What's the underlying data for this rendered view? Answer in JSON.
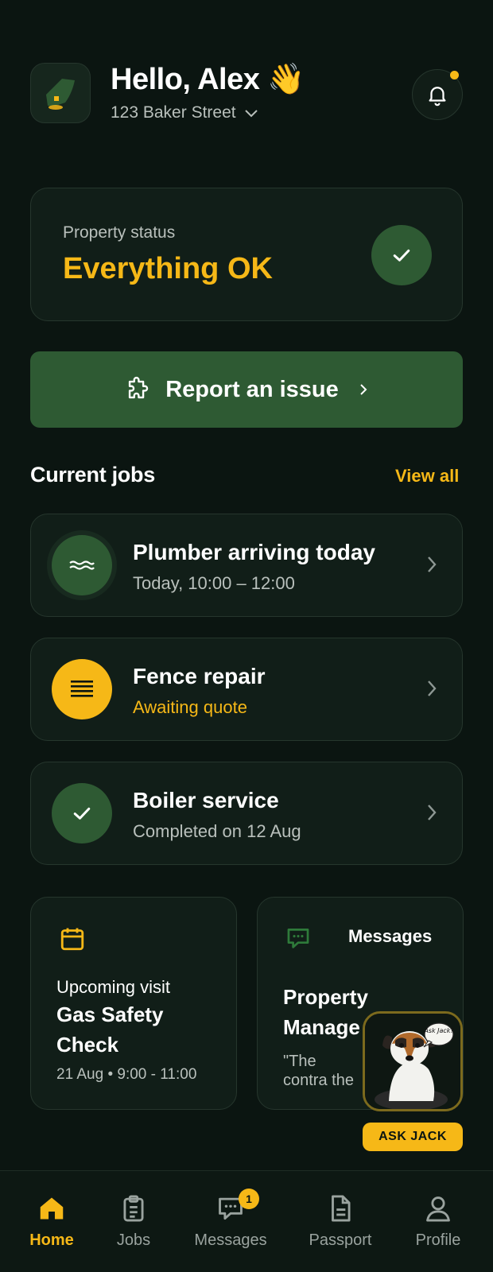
{
  "header": {
    "greeting": "Hello, Alex 👋",
    "address": "123 Baker Street",
    "notification_dot": true
  },
  "status": {
    "label": "Property status",
    "value": "Everything OK"
  },
  "report_button": {
    "label": "Report an issue"
  },
  "jobs_section": {
    "title": "Current jobs",
    "view_all": "View all",
    "jobs": [
      {
        "title": "Plumber arriving today",
        "subtitle": "Today, 10:00 – 12:00",
        "icon": "water-wave-icon"
      },
      {
        "title": "Fence repair",
        "subtitle": "Awaiting quote",
        "icon": "fence-lines-icon"
      },
      {
        "title": "Boiler service",
        "subtitle": "Completed on 12 Aug",
        "icon": "check-icon"
      }
    ]
  },
  "upcoming": {
    "label": "Upcoming visit",
    "title": "Gas Safety Check",
    "meta": "21 Aug • 9:00 - 11:00"
  },
  "messages_card": {
    "label": "Messages",
    "title": "Property Manage",
    "quote": "\"The contra the way.\""
  },
  "ask_jack": {
    "button": "ASK JACK",
    "bubble": "Ask Jack?"
  },
  "tabbar": {
    "tabs": [
      {
        "label": "Home",
        "icon": "home-icon",
        "active": true
      },
      {
        "label": "Jobs",
        "icon": "clipboard-icon",
        "active": false
      },
      {
        "label": "Messages",
        "icon": "message-icon",
        "active": false,
        "badge": "1"
      },
      {
        "label": "Passport",
        "icon": "document-icon",
        "active": false
      },
      {
        "label": "Profile",
        "icon": "user-icon",
        "active": false
      }
    ]
  },
  "colors": {
    "background": "#0b1511",
    "card": "#111e18",
    "accent": "#f6b817",
    "green": "#2e5a33",
    "muted": "#b9c0bc"
  }
}
